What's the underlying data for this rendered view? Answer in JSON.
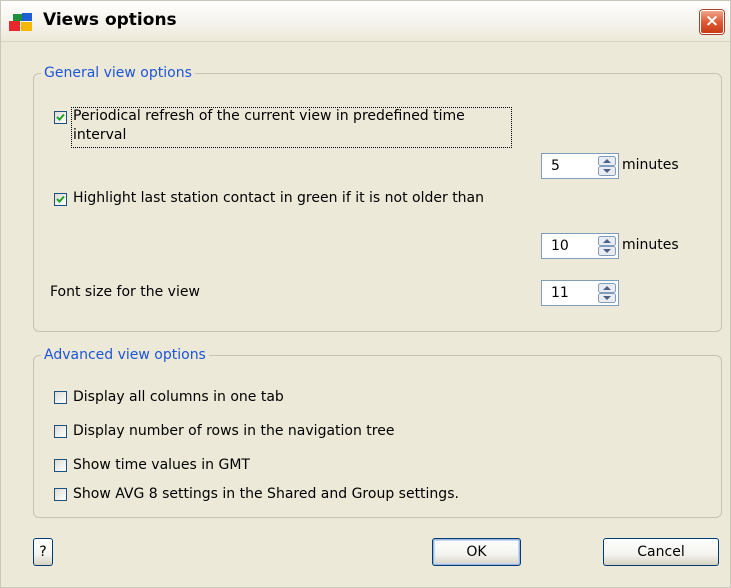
{
  "window": {
    "title": "Views options",
    "close_label": "×"
  },
  "general": {
    "title": "General view options",
    "refresh": {
      "checked": true,
      "label_line1": "Periodical refresh of the current view in predefined time",
      "label_line2": "interval",
      "value": "5",
      "unit": "minutes"
    },
    "highlight": {
      "checked": true,
      "label": "Highlight last station contact in green if it is not older than",
      "value": "10",
      "unit": "minutes"
    },
    "font_size": {
      "label": "Font size for the view",
      "value": "11"
    }
  },
  "advanced": {
    "title": "Advanced view options",
    "options": [
      {
        "label": "Display all columns in one tab",
        "checked": false
      },
      {
        "label": "Display number of rows in the navigation tree",
        "checked": false
      },
      {
        "label": "Show time values in GMT",
        "checked": false
      },
      {
        "label": "Show AVG 8 settings in the Shared and Group settings.",
        "checked": false
      }
    ]
  },
  "buttons": {
    "help": "?",
    "ok": "OK",
    "cancel": "Cancel"
  },
  "colors": {
    "group_title": "#1c55d8",
    "check_mark": "#21a121",
    "close_button": "#e05a35"
  },
  "icons": {
    "app": "avg-logo-icon",
    "close": "close-icon",
    "spin": "spinner-arrows-icon",
    "check": "checkmark-icon"
  }
}
